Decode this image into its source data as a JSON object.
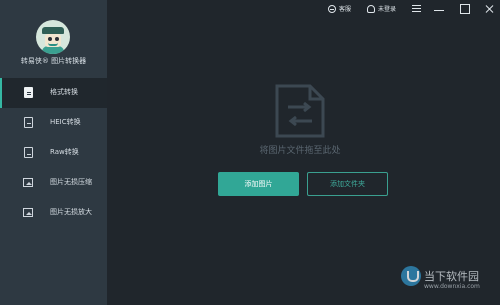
{
  "app": {
    "brand": "转易侠® 图片转换器"
  },
  "topbar": {
    "service_label": "客服",
    "login_label": "未登录"
  },
  "sidebar": {
    "items": [
      {
        "label": "格式转换",
        "icon": "format-convert-icon",
        "active": true
      },
      {
        "label": "HEIC转换",
        "icon": "heic-file-icon",
        "active": false
      },
      {
        "label": "Raw转换",
        "icon": "raw-file-icon",
        "active": false
      },
      {
        "label": "图片无损压缩",
        "icon": "image-compress-icon",
        "active": false
      },
      {
        "label": "图片无损放大",
        "icon": "image-enlarge-icon",
        "active": false
      }
    ]
  },
  "main": {
    "drop_text": "将图片文件拖至此处",
    "add_image_label": "添加图片",
    "add_folder_label": "添加文件夹"
  },
  "watermark": {
    "name": "当下软件园",
    "url": "www.downxia.com"
  },
  "colors": {
    "accent": "#31a796",
    "sidebar_bg": "#2e3942",
    "main_bg": "#20262c"
  }
}
